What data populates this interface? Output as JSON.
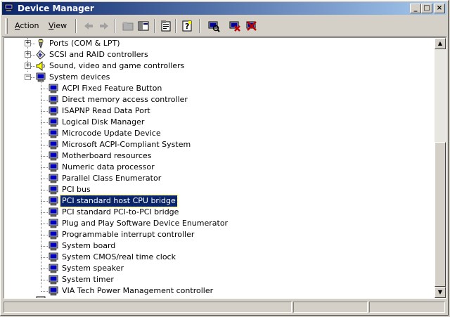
{
  "window": {
    "title": "Device Manager",
    "buttons": {
      "minimize": "_",
      "maximize": "□",
      "close": "×"
    }
  },
  "menubar": {
    "items": [
      {
        "pre": "",
        "accel": "A",
        "post": "ction"
      },
      {
        "pre": "",
        "accel": "V",
        "post": "iew"
      }
    ]
  },
  "toolbar": {
    "icons": [
      "back-icon",
      "forward-icon",
      "up-folder-icon",
      "show-hide-tree-icon",
      "properties-icon",
      "help-icon",
      "scan-hardware-icon",
      "uninstall-icon",
      "disable-device-icon"
    ]
  },
  "tree": {
    "categories": [
      {
        "label": "Ports (COM & LPT)",
        "expanded": false,
        "icon": "port-icon"
      },
      {
        "label": "SCSI and RAID controllers",
        "expanded": false,
        "icon": "scsi-icon"
      },
      {
        "label": "Sound, video and game controllers",
        "expanded": false,
        "icon": "sound-icon"
      },
      {
        "label": "System devices",
        "expanded": true,
        "icon": "computer-icon"
      }
    ],
    "devices": [
      "ACPI Fixed Feature Button",
      "Direct memory access controller",
      "ISAPNP Read Data Port",
      "Logical Disk Manager",
      "Microcode Update Device",
      "Microsoft ACPI-Compliant System",
      "Motherboard resources",
      "Numeric data processor",
      "Parallel Class Enumerator",
      "PCI bus",
      "PCI standard host CPU bridge",
      "PCI standard PCI-to-PCI bridge",
      "Plug and Play Software Device Enumerator",
      "Programmable interrupt controller",
      "System board",
      "System CMOS/real time clock",
      "System speaker",
      "System timer",
      "VIA Tech Power Management controller"
    ],
    "selected_device": "PCI standard host CPU bridge",
    "expander_collapsed": "+",
    "expander_expanded": "−"
  },
  "scrollbar": {
    "up": "▲",
    "down": "▼"
  },
  "colors": {
    "titlebar_start": "#0a246a",
    "titlebar_end": "#a6caf0",
    "selection": "#0a246a"
  }
}
